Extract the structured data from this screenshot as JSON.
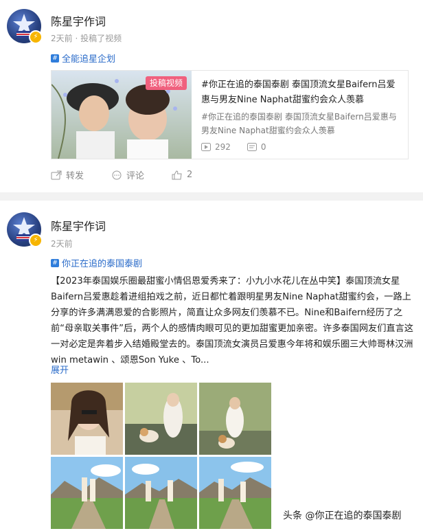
{
  "posts": [
    {
      "author": "陈星宇作词",
      "meta": "2天前 · 投稿了视频",
      "topic": "全能追星企划",
      "card": {
        "tag": "投稿视频",
        "title": "#你正在追的泰国泰剧 泰国顶流女星Baifern吕爱惠与男友Nine Naphat甜蜜约会众人羡慕",
        "desc": "#你正在追的泰国泰剧 泰国顶流女星Baifern吕爱惠与男友Nine Naphat甜蜜约会众人羡慕",
        "plays": "292",
        "comments": "0"
      },
      "actions": {
        "repost": "转发",
        "comment": "评论",
        "likes": "2"
      }
    },
    {
      "author": "陈星宇作词",
      "meta": "2天前",
      "topic": "你正在追的泰国泰剧",
      "text": "【2023年泰国娱乐圈最甜蜜小情侣恩爱秀来了：小九小水花儿在丛中笑】泰国顶流女星Baifern吕爱惠趁着进组拍戏之前，近日都忙着跟明星男友Nine Naphat甜蜜约会，一路上分享的许多满满恩爱的合影照片，简直让众多网友们羡慕不已。Nine和Baifern经历了之前“母亲取关事件”后，两个人的感情肉眼可见的更加甜蜜更加亲密。许多泰国网友们直言这一对必定是奔着步入结婚殿堂去的。泰国顶流女演员吕爱惠今年将和娱乐圈三大帅哥林汉洲win metawin 、颂恩Son Yuke 、To...",
      "expand": "展开"
    }
  ],
  "watermark": "头条 @你正在追的泰国泰剧",
  "colors": {
    "link": "#2a6bc9",
    "badge": "#f7b500",
    "tag": "#f0607e"
  }
}
